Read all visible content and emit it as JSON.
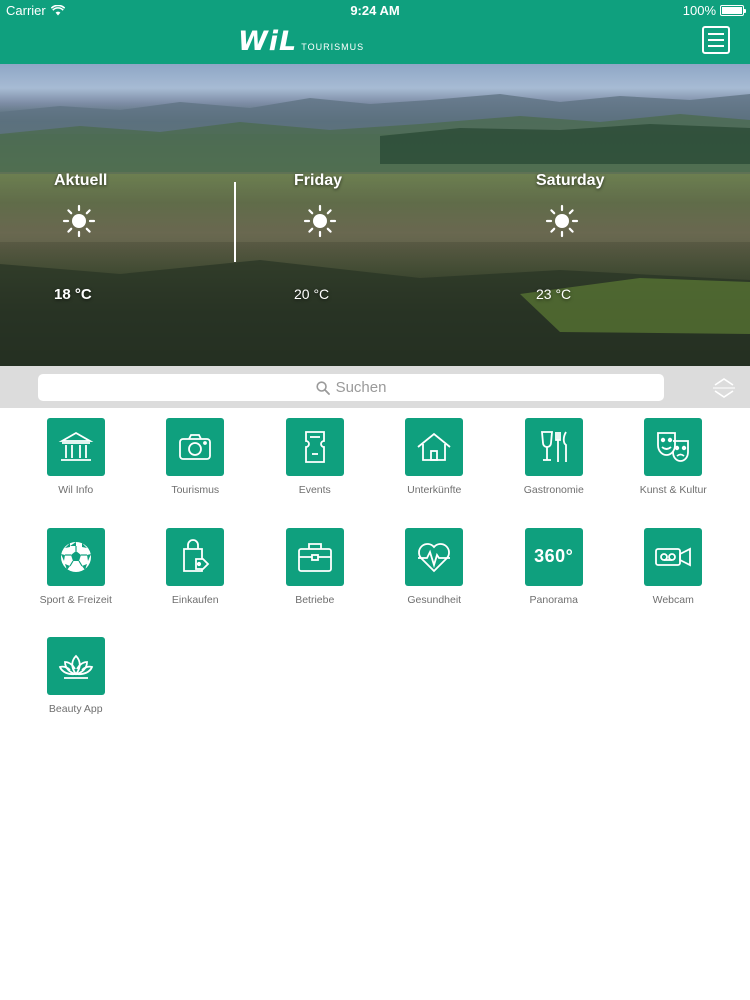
{
  "status_bar": {
    "carrier": "Carrier",
    "time": "9:24 AM",
    "battery": "100%"
  },
  "header": {
    "logo_mark": "WiL",
    "logo_sub": "TOURISMUS"
  },
  "weather": [
    {
      "day": "Aktuell",
      "temp": "18 °C",
      "icon": "sun-icon"
    },
    {
      "day": "Friday",
      "temp": "20 °C",
      "icon": "sun-icon"
    },
    {
      "day": "Saturday",
      "temp": "23 °C",
      "icon": "sun-icon"
    }
  ],
  "search": {
    "placeholder": "Suchen"
  },
  "categories": [
    {
      "label": "Wil Info",
      "icon": "building-icon"
    },
    {
      "label": "Tourismus",
      "icon": "camera-icon"
    },
    {
      "label": "Events",
      "icon": "ticket-icon"
    },
    {
      "label": "Unterkünfte",
      "icon": "house-icon"
    },
    {
      "label": "Gastronomie",
      "icon": "dining-icon"
    },
    {
      "label": "Kunst & Kultur",
      "icon": "theater-masks-icon"
    },
    {
      "label": "Sport & Freizeit",
      "icon": "soccer-ball-icon"
    },
    {
      "label": "Einkaufen",
      "icon": "shopping-bag-icon"
    },
    {
      "label": "Betriebe",
      "icon": "briefcase-icon"
    },
    {
      "label": "Gesundheit",
      "icon": "heart-pulse-icon"
    },
    {
      "label": "Panorama",
      "icon": "panorama-360-icon",
      "icon_text": "360°"
    },
    {
      "label": "Webcam",
      "icon": "video-camera-icon"
    },
    {
      "label": "Beauty App",
      "icon": "lotus-icon"
    }
  ],
  "colors": {
    "brand": "#0fa07e",
    "label": "#6f6f6f",
    "search_bg": "#dcdcdc"
  }
}
